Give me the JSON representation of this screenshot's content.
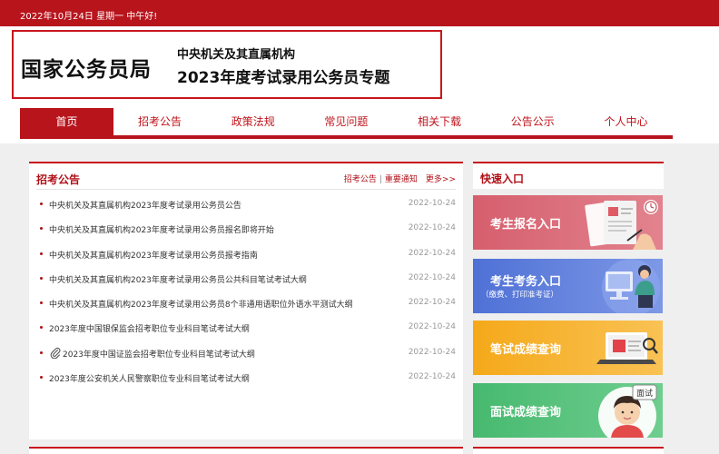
{
  "topbar": {
    "text": "2022年10月24日  星期一  中午好!"
  },
  "header": {
    "logo_text": "国家公务员局",
    "subtitle1": "中央机关及其直属机构",
    "subtitle2": "2023年度考试录用公务员专题"
  },
  "nav": {
    "items": [
      {
        "label": "首页",
        "active": true
      },
      {
        "label": "招考公告"
      },
      {
        "label": "政策法规"
      },
      {
        "label": "常见问题"
      },
      {
        "label": "相关下载"
      },
      {
        "label": "公告公示"
      },
      {
        "label": "个人中心"
      }
    ]
  },
  "announcements": {
    "title": "招考公告",
    "tab1": "招考公告",
    "separator": "|",
    "tab2": "重要通知",
    "more": "更多>>",
    "items": [
      {
        "title": "中央机关及其直属机构2023年度考试录用公务员公告",
        "date": "2022-10-24"
      },
      {
        "title": "中央机关及其直属机构2023年度考试录用公务员报名即将开始",
        "date": "2022-10-24"
      },
      {
        "title": "中央机关及其直属机构2023年度考试录用公务员报考指南",
        "date": "2022-10-24"
      },
      {
        "title": "中央机关及其直属机构2023年度考试录用公务员公共科目笔试考试大纲",
        "date": "2022-10-24"
      },
      {
        "title": "中央机关及其直属机构2023年度考试录用公务员8个非通用语职位外语水平测试大纲",
        "date": "2022-10-24"
      },
      {
        "title": "2023年度中国银保监会招考职位专业科目笔试考试大纲",
        "date": "2022-10-24"
      },
      {
        "title": "2023年度中国证监会招考职位专业科目笔试考试大纲",
        "date": "2022-10-24",
        "attachment_icon": "paperclip-icon"
      },
      {
        "title": "2023年度公安机关人民警察职位专业科目笔试考试大纲",
        "date": "2022-10-24"
      }
    ]
  },
  "quick_entry": {
    "title": "快速入口",
    "cards": [
      {
        "label": "考生报名入口",
        "icon": "registration-form-icon",
        "color": "#dc6c79"
      },
      {
        "label": "考生考务入口",
        "note": "（缴费、打印准考证）",
        "icon": "computer-user-icon",
        "color": "#5b7ddb"
      },
      {
        "label": "笔试成绩查询",
        "icon": "laptop-magnifier-icon",
        "color": "#f6b02a"
      },
      {
        "label": "面试成绩查询",
        "icon": "interview-avatar-icon",
        "badge": "面试",
        "color": "#52bf78"
      }
    ]
  },
  "colors": {
    "brand_red": "#b8141c",
    "page_gray": "#efefef"
  }
}
